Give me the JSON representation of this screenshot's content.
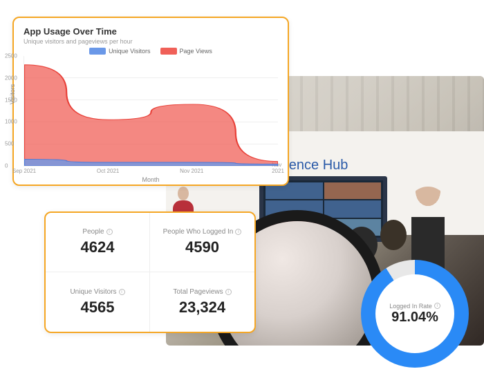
{
  "photo": {
    "banner": "Science Hub"
  },
  "chart": {
    "title": "App Usage Over Time",
    "subtitle": "Unique visitors and pageviews per hour",
    "xlabel": "Month",
    "ylabel": "Visitors",
    "legend": {
      "uv": "Unique Visitors",
      "pv": "Page Views"
    },
    "yticks": [
      "0",
      "500",
      "1000",
      "1500",
      "2000",
      "2500"
    ],
    "xticks": [
      "Sep 2021",
      "Oct 2021",
      "Nov 2021",
      "Nov 2021"
    ]
  },
  "chart_data": {
    "type": "area",
    "title": "App Usage Over Time",
    "xlabel": "Month",
    "ylabel": "Visitors",
    "ylim": [
      0,
      2500
    ],
    "categories": [
      "Sep 2021",
      "Oct 2021",
      "Nov 2021",
      "Nov 2021"
    ],
    "series": [
      {
        "name": "Page Views",
        "values": [
          2300,
          1050,
          1400,
          100
        ],
        "color": "#f06058"
      },
      {
        "name": "Unique Visitors",
        "values": [
          150,
          80,
          80,
          40
        ],
        "color": "#6a98e8"
      }
    ],
    "legend_position": "top"
  },
  "stats": {
    "cells": [
      {
        "label": "People",
        "value": "4624"
      },
      {
        "label": "People Who Logged In",
        "value": "4590"
      },
      {
        "label": "Unique Visitors",
        "value": "4565"
      },
      {
        "label": "Total Pageviews",
        "value": "23,324"
      }
    ]
  },
  "donut": {
    "label": "Logged In Rate",
    "value": "91.04%",
    "percent": 91.04
  }
}
